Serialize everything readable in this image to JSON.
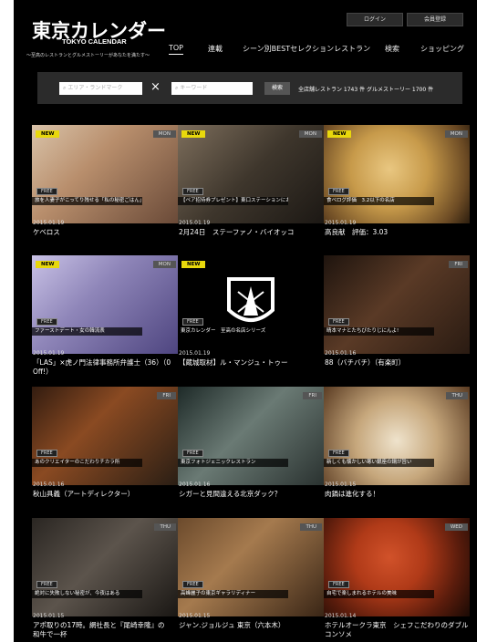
{
  "header": {
    "logo_jp": "東京カレンダー",
    "logo_en": "TOKYO CALENDAR",
    "tagline": "〜至高のレストランとグルメストーリーがあなたを満たす〜",
    "login": "ログイン",
    "register": "会員登録"
  },
  "nav": [
    {
      "label": "TOP"
    },
    {
      "label": "連載"
    },
    {
      "label": "シーン別BESTセレクションレストラン"
    },
    {
      "label": "検索"
    },
    {
      "label": "ショッピング"
    }
  ],
  "search": {
    "area_placeholder": "エリア・ランドマーク",
    "cross": "×",
    "keyword_placeholder": "キーワード",
    "button": "検索",
    "counts": "全店舗レストラン 1743 件 グルメストーリー 1700 件"
  },
  "cards": [
    {
      "new": "NEW",
      "day": "MON",
      "free": "FREE",
      "caption": "旅を人妻子がこってり残せる「私の秘密ごはん」",
      "date": "2015.01.19",
      "title": "ケベロス"
    },
    {
      "new": "NEW",
      "day": "MON",
      "free": "FREE",
      "caption": "【ペア招待券プレゼント】東口ステーションにお転婆ガラ ノイー＠ブルガリ イル・リストランテ",
      "date": "2015.01.19",
      "title": "2月24日　ステーファノ・バイオッコ"
    },
    {
      "new": "NEW",
      "day": "MON",
      "free": "FREE",
      "caption": "食ベログ評価　3.2以下の名店",
      "date": "2015.01.19",
      "title": "高良献　評価：3.03"
    },
    {
      "new": "NEW",
      "day": "MON",
      "free": "FREE",
      "caption": "ファーストデート・女の韓流表",
      "date": "2015.01.19",
      "title": "「LAS」×虎ノ門法律事務所弁護士（36）（0　Off!）"
    },
    {
      "new": "NEW",
      "day": "",
      "free": "FREE",
      "caption": "東京カレンダー　至高の名店シリーズ",
      "date": "2015.01.19",
      "title": "【蔵城取材】ル・マンジュ・トゥー"
    },
    {
      "new": "",
      "day": "FRI",
      "free": "FREE",
      "caption": "晴本マナとたちびたりじにんよ!",
      "date": "2015.01.16",
      "title": "88（バチバチ）（有楽町）"
    },
    {
      "new": "",
      "day": "FRI",
      "free": "FREE",
      "caption": "あのクリエイターのこだわりチカラ所",
      "date": "2015.01.16",
      "title": "秋山具義（アートディレクター）"
    },
    {
      "new": "",
      "day": "FRI",
      "free": "FREE",
      "caption": "東京フォトジェニックレストラン",
      "date": "2015.01.16",
      "title": "シガーと見間違える北京ダック？"
    },
    {
      "new": "",
      "day": "THU",
      "free": "FREE",
      "caption": "新しくも懐かしい寒い銀座の鍋が旨い",
      "date": "2015.01.15",
      "title": "肉鍋は進化する！"
    },
    {
      "new": "",
      "day": "THU",
      "free": "FREE",
      "caption": "絶対に失敗しない秘密が、今夜はある",
      "date": "2015.01.15",
      "title": "アポ取りの17時。網社長と『尾崎幸隆』の　和牛で一杯"
    },
    {
      "new": "",
      "day": "THU",
      "free": "FREE",
      "caption": "高峰麗子の東京ギャラリディナー",
      "date": "2015.01.15",
      "title": "ジャン.ジョルジュ 東京（六本木）"
    },
    {
      "new": "",
      "day": "WED",
      "free": "FREE",
      "caption": "自宅で楽しまれるホテルの美味",
      "date": "2015.01.14",
      "title": "ホテルオークラ東京　シェフこだわりのダブルコンソメ"
    }
  ]
}
